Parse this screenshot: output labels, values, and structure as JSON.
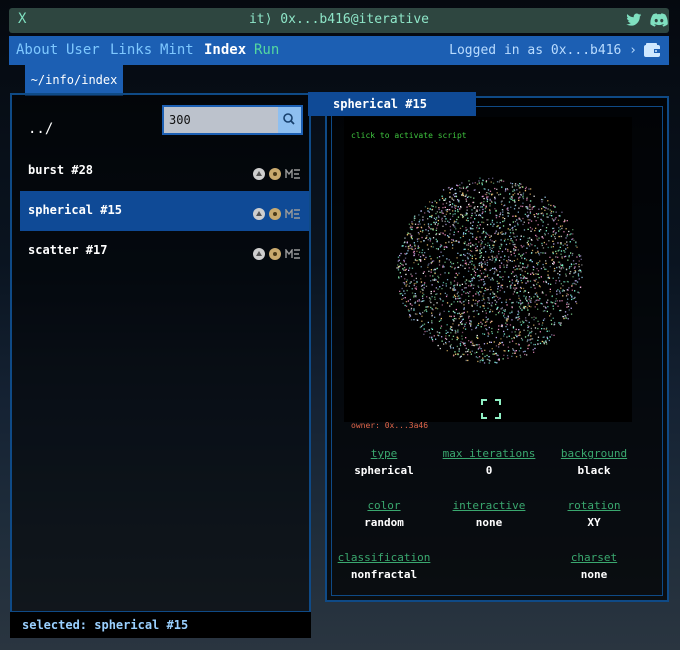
{
  "titlebar": {
    "close": "X",
    "title": "it⟩ 0x...b416@iterative",
    "twitter_icon": "twitter-bird",
    "discord_icon": "discord-logo"
  },
  "nav": {
    "items": [
      {
        "label": "About"
      },
      {
        "label": "User"
      },
      {
        "label": "Links"
      },
      {
        "label": "Mint"
      },
      {
        "label": "Index"
      },
      {
        "label": "Run"
      }
    ],
    "active": "Index",
    "user_status": "Logged in as 0x...b416 ›",
    "wallet_icon": "wallet"
  },
  "breadcrumb": "~/info/index",
  "list": {
    "up": "../",
    "search_value": "300",
    "items": [
      {
        "label": "burst #28"
      },
      {
        "label": "spherical #15"
      },
      {
        "label": "scatter #17"
      }
    ],
    "selected_index": 1
  },
  "status": "selected: spherical #15",
  "detail": {
    "tab": "spherical #15",
    "hint": "click to activate script",
    "owner": "owner: 0x...3a46",
    "props": [
      {
        "key": "type",
        "value": "spherical"
      },
      {
        "key": "max iterations",
        "value": "0"
      },
      {
        "key": "background",
        "value": "black"
      },
      {
        "key": "color",
        "value": "random"
      },
      {
        "key": "interactive",
        "value": "none"
      },
      {
        "key": "rotation",
        "value": "XY"
      },
      {
        "key": "classification",
        "value": "nonfractal"
      },
      {
        "key": "charset",
        "value": "none"
      }
    ]
  },
  "colors": {
    "nav_bg": "#1c5fb3",
    "selected_bg": "#0f4a96",
    "accent_green": "#3aa86f",
    "owner_red": "#e0664a"
  }
}
